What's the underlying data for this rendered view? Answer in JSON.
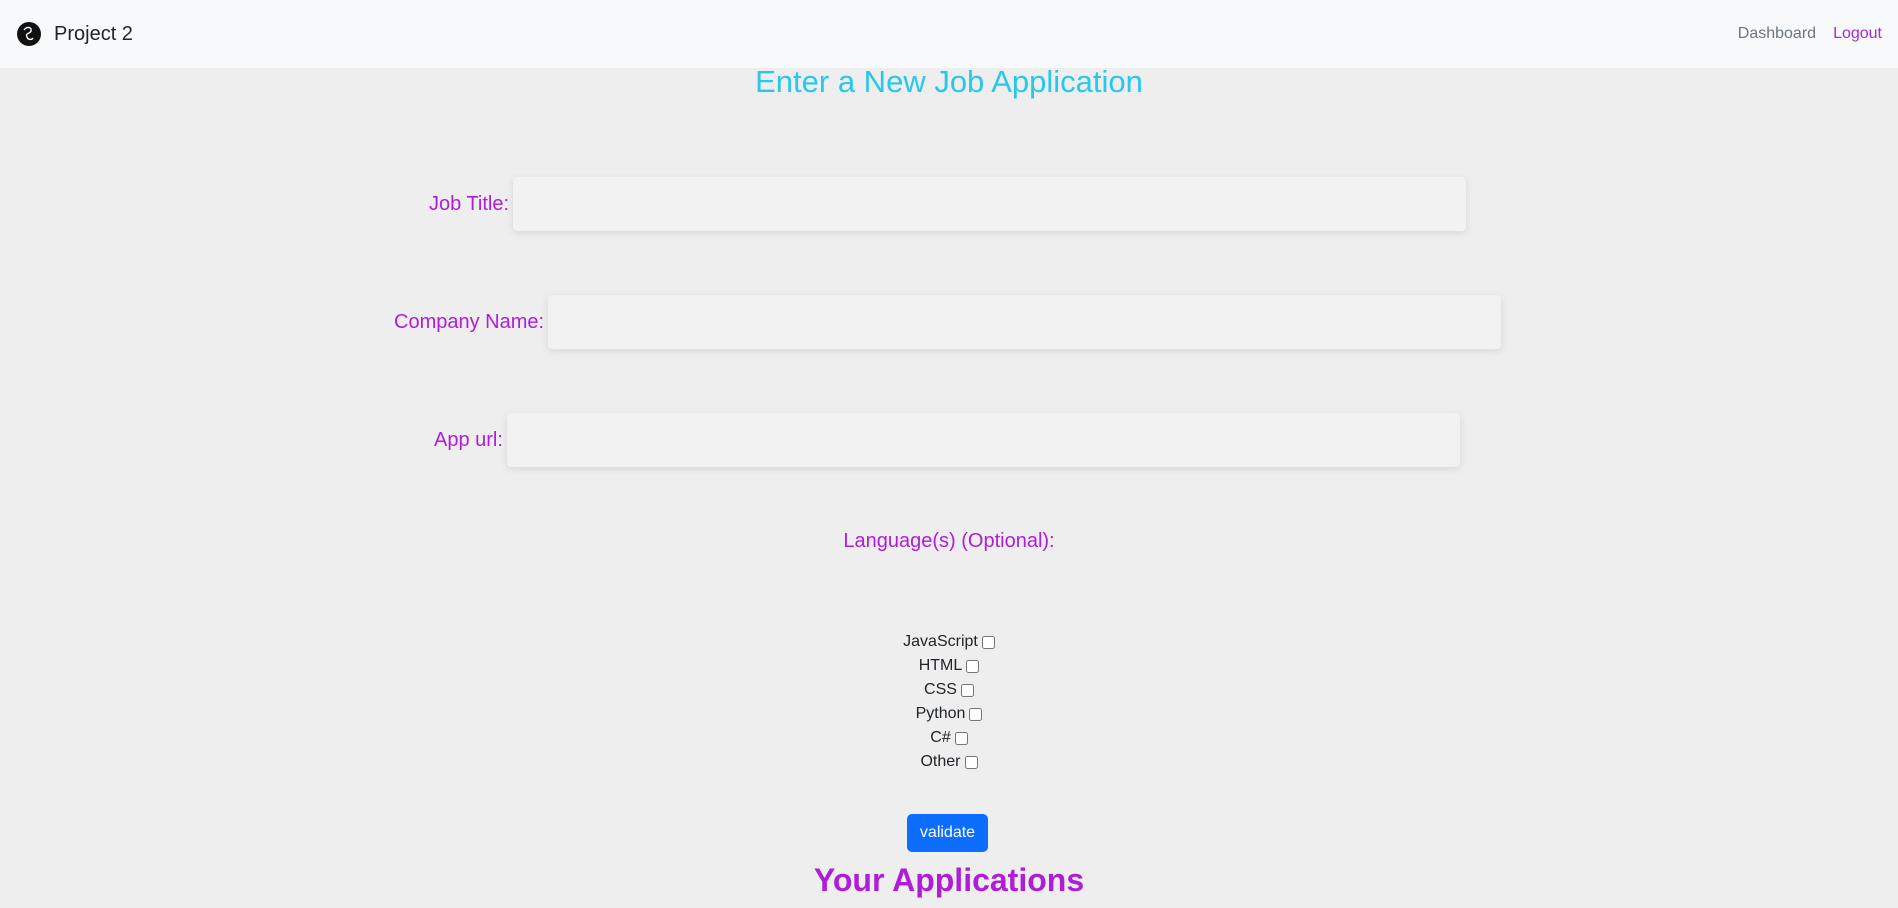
{
  "navbar": {
    "brand": "Project 2",
    "logo_icon": "bird-icon",
    "links": {
      "dashboard": "Dashboard",
      "logout": "Logout"
    }
  },
  "form": {
    "title": "Enter a New Job Application",
    "fields": {
      "job_title": {
        "label": "Job Title:",
        "value": ""
      },
      "company_name": {
        "label": "Company Name:",
        "value": ""
      },
      "app_url": {
        "label": "App url:",
        "value": ""
      }
    },
    "languages_label": "Language(s) (Optional):",
    "languages": [
      {
        "label": "JavaScript",
        "checked": false
      },
      {
        "label": "HTML",
        "checked": false
      },
      {
        "label": "CSS",
        "checked": false
      },
      {
        "label": "Python",
        "checked": false
      },
      {
        "label": "C#",
        "checked": false
      },
      {
        "label": "Other",
        "checked": false
      }
    ],
    "submit_label": "validate"
  },
  "applications": {
    "heading": "Your Applications"
  },
  "colors": {
    "title": "#27c8ec",
    "label": "#b01dd8",
    "button": "#0d6efd",
    "background": "#eeeeee"
  }
}
